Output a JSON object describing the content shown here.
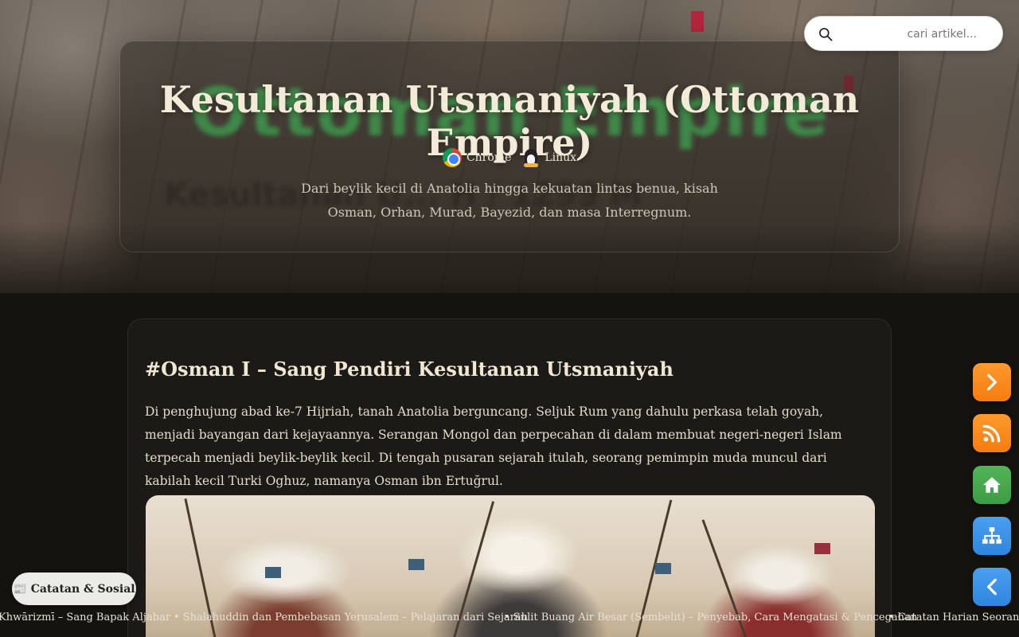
{
  "hero": {
    "title": "Kesultanan Utsmaniyah (Ottoman Empire)",
    "background_title": "Ottoman Empire",
    "background_subtitle": "Kesultanan U... H / 1299 M",
    "platforms": [
      {
        "name": "Chrome",
        "icon": "chrome-icon"
      },
      {
        "name": "Linux",
        "icon": "linux-icon"
      }
    ],
    "description": "Dari beylik kecil di Anatolia hingga kekuatan lintas benua, kisah Osman, Orhan, Murad, Bayezid, dan masa Interregnum."
  },
  "search": {
    "placeholder": "cari artikel..."
  },
  "article": {
    "heading": "#Osman I – Sang Pendiri Kesultanan Utsmaniyah",
    "paragraph": "Di penghujung abad ke-7 Hijriah, tanah Anatolia berguncang. Seljuk Rum yang dahulu perkasa telah goyah, menjadi bayangan dari kejayaannya. Serangan Mongol dan perpecahan di dalam membuat negeri-negeri Islam terpecah menjadi beylik-beylik kecil. Di tengah pusaran sejarah itulah, seorang pemimpin muda muncul dari kabilah kecil Turki Oghuz, namanya Osman ibn Ertuğrul."
  },
  "floating_buttons": [
    {
      "name": "next-button",
      "icon": "chevron-right-icon",
      "color": "#f57c0f"
    },
    {
      "name": "rss-button",
      "icon": "rss-icon",
      "color": "#f57c0f"
    },
    {
      "name": "home-button",
      "icon": "home-icon",
      "color": "#3d9b44"
    },
    {
      "name": "sitemap-button",
      "icon": "sitemap-icon",
      "color": "#2f86df"
    },
    {
      "name": "prev-button",
      "icon": "chevron-left-icon",
      "color": "#2f86df"
    }
  ],
  "social": {
    "label": "📰 Catatan & Sosial"
  },
  "ticker": {
    "items": [
      "Khwārizmī – Sang Bapak Aljabar",
      "• Shalahuddin dan Pembebasan Yerusalem – Pelajaran dari Sejarah",
      "• Sulit Buang Air Besar (Sembelit) – Penyebab, Cara Mengatasi & Pencegahan",
      "• Catatan Harian Seorang Wa"
    ]
  }
}
